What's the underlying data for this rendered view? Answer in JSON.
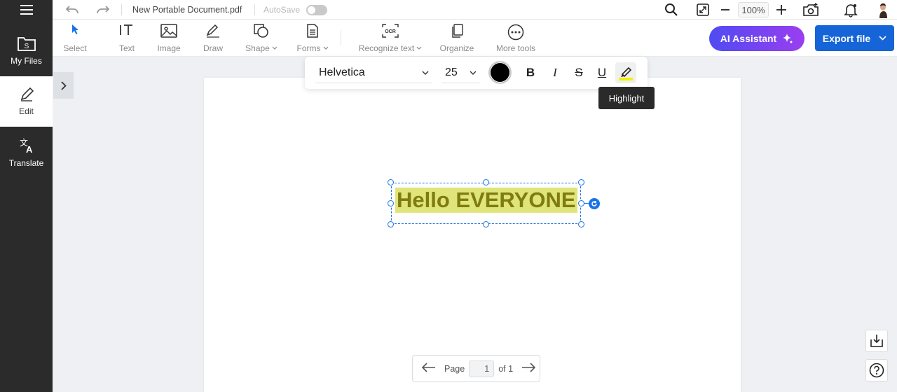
{
  "sidebar": {
    "items": [
      {
        "label": "My Files"
      },
      {
        "label": "Edit"
      },
      {
        "label": "Translate"
      }
    ]
  },
  "topbar": {
    "filename": "New Portable Document.pdf",
    "autosave_label": "AutoSave",
    "autosave_enabled": false,
    "zoom": "100%"
  },
  "toolbar": {
    "tools": [
      {
        "label": "Select"
      },
      {
        "label": "Text"
      },
      {
        "label": "Image"
      },
      {
        "label": "Draw"
      },
      {
        "label": "Shape"
      },
      {
        "label": "Forms"
      },
      {
        "label": "Recognize text"
      },
      {
        "label": "Organize"
      },
      {
        "label": "More tools"
      }
    ],
    "ai_assistant": "AI Assistant",
    "export": "Export file"
  },
  "format_bar": {
    "font": "Helvetica",
    "size": "25",
    "color": "#000000",
    "bold": "B",
    "italic": "I",
    "strike": "S",
    "underline": "U",
    "highlight_color": "#f2f200"
  },
  "tooltip": "Highlight",
  "document": {
    "text": "Hello EVERYONE"
  },
  "pagenav": {
    "label": "Page",
    "current": "1",
    "total": "of 1"
  }
}
